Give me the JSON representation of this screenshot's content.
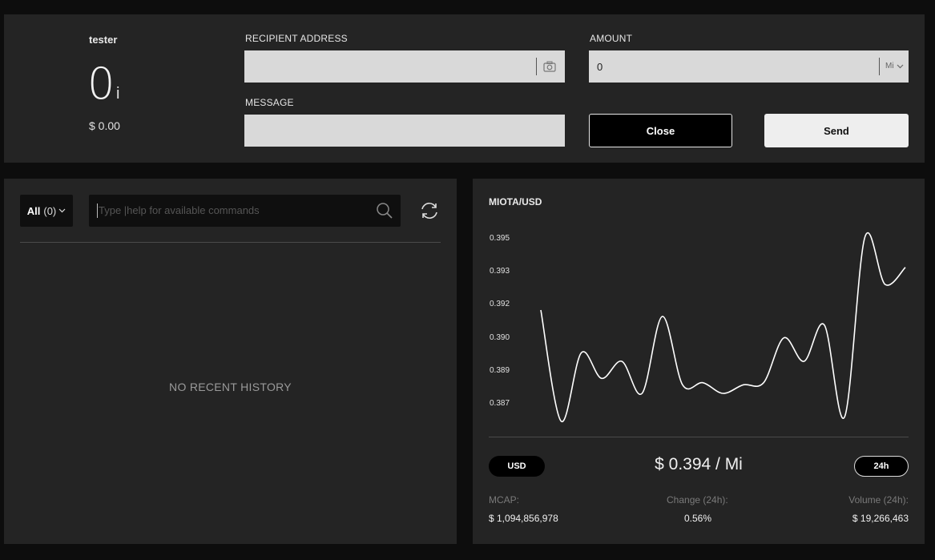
{
  "account": {
    "name": "tester",
    "balance": "0",
    "unit": "i",
    "fiat": "$ 0.00"
  },
  "send": {
    "recipient_label": "RECIPIENT ADDRESS",
    "recipient_value": "",
    "message_label": "MESSAGE",
    "message_value": "",
    "amount_label": "AMOUNT",
    "amount_value": "0",
    "amount_unit": "Mi",
    "close_label": "Close",
    "send_label": "Send"
  },
  "history": {
    "filter_label": "All",
    "filter_count": "(0)",
    "command_placeholder": "Type |help for available commands",
    "empty_message": "NO RECENT HISTORY"
  },
  "market": {
    "pair": "MIOTA/USD",
    "currency_button": "USD",
    "price": "$ 0.394 / Mi",
    "timeframe_button": "24h",
    "mcap_label": "MCAP:",
    "mcap_value": "$ 1,094,856,978",
    "change_label": "Change (24h):",
    "change_value": "0.56%",
    "volume_label": "Volume (24h):",
    "volume_value": "$ 19,266,463"
  },
  "chart_data": {
    "type": "line",
    "title": "MIOTA/USD",
    "y_ticks": [
      "0.395",
      "0.393",
      "0.392",
      "0.390",
      "0.389",
      "0.387"
    ],
    "ylim": [
      0.3866,
      0.3956
    ],
    "series": [
      {
        "values": [
          0.3917,
          0.3865,
          0.3897,
          0.3885,
          0.3893,
          0.3878,
          0.3914,
          0.3882,
          0.3883,
          0.3878,
          0.3882,
          0.3883,
          0.3904,
          0.3893,
          0.391,
          0.3867,
          0.3951,
          0.3929,
          0.3937
        ]
      }
    ],
    "line_color": "#ffffff",
    "grid": false
  }
}
